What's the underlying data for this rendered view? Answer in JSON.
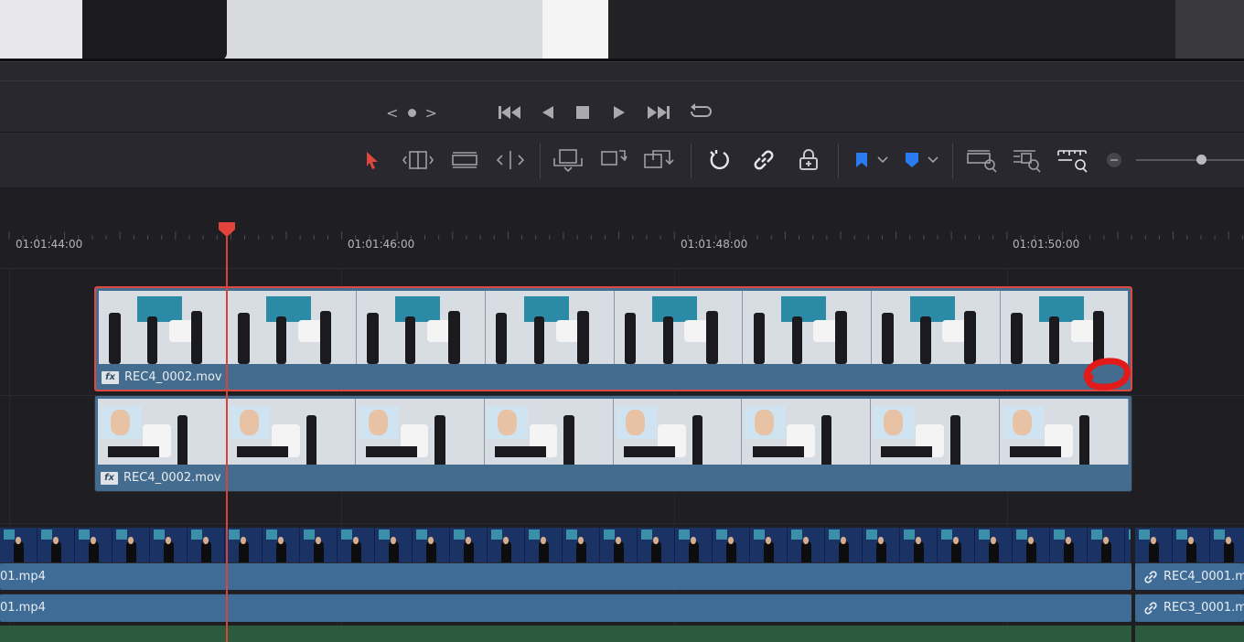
{
  "transport": {
    "jog_left": "<",
    "jog_right": ">",
    "controls": [
      "skip-to-start-icon",
      "play-reverse-icon",
      "stop-icon",
      "play-icon",
      "skip-to-end-icon",
      "loop-icon"
    ]
  },
  "toolbar": {
    "tools": [
      "selection-arrow-icon",
      "trim-edit-icon",
      "dynamic-trim-icon",
      "blade-icon",
      "insert-clip-icon",
      "overwrite-clip-icon",
      "replace-clip-icon",
      "snapping-icon",
      "linked-selection-icon",
      "position-lock-icon",
      "flag-icon",
      "marker-icon",
      "full-extent-zoom-icon",
      "detail-zoom-icon",
      "custom-zoom-icon",
      "zoom-out-icon"
    ],
    "zoom_level": 0.75
  },
  "ruler": {
    "timecodes": [
      "01:01:44:00",
      "01:01:46:00",
      "01:01:48:00",
      "01:01:50:00"
    ]
  },
  "tracks": {
    "v2_clip": {
      "name": "REC4_0002.mov",
      "fx": "fx"
    },
    "v1_clip": {
      "name": "REC4_0002.mov",
      "fx": "fx"
    },
    "a1_left": "01.mp4",
    "a1_right": "REC4_0001.m",
    "a2_left": "01.mp4",
    "a2_right": "REC3_0001.m"
  },
  "colors": {
    "playhead": "#d8433b",
    "clip": "#436c8e",
    "selected_border": "#e0473f",
    "annotation": "#e21a1a"
  }
}
